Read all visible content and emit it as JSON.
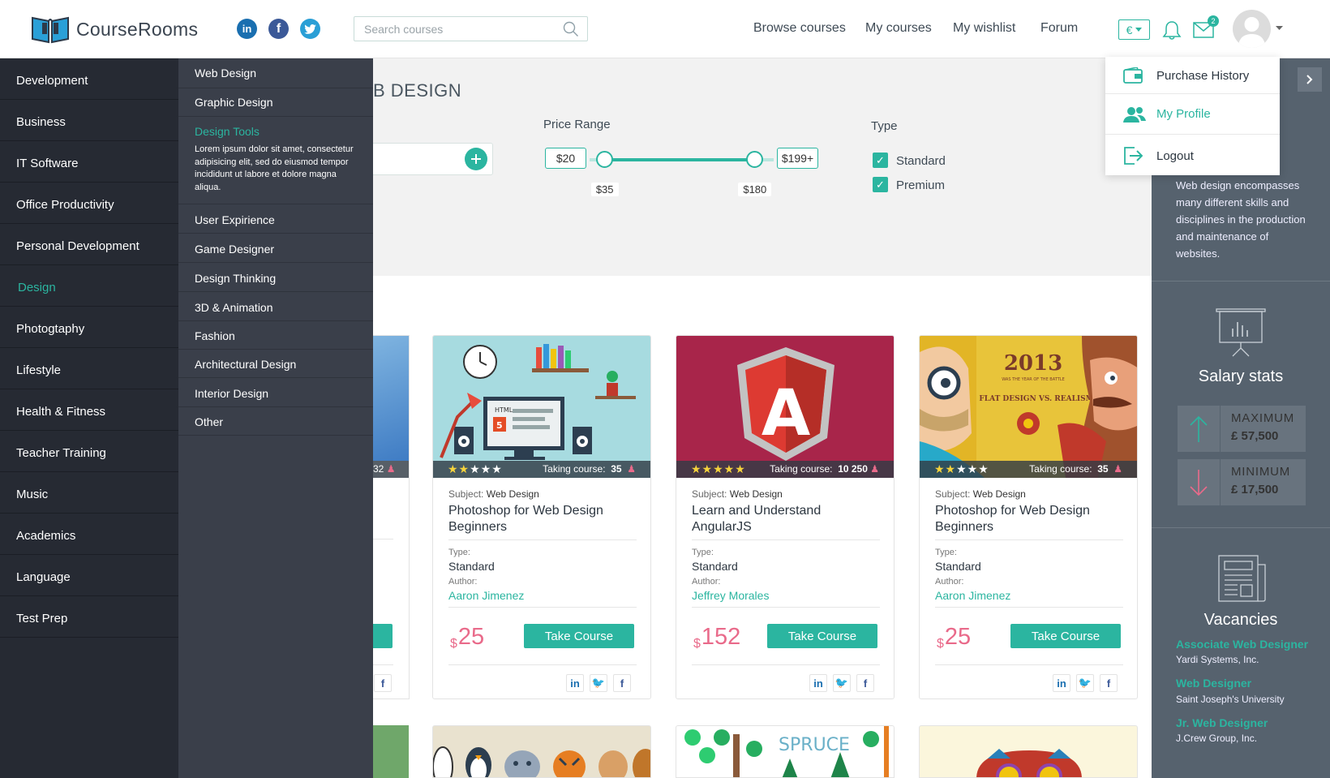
{
  "brand": {
    "name": "CourseRooms"
  },
  "social": {
    "linkedin": "in",
    "facebook": "f",
    "twitter": "t"
  },
  "search": {
    "placeholder": "Search courses"
  },
  "nav": {
    "browse": "Browse courses",
    "mycourses": "My courses",
    "wishlist": "My wishlist",
    "forum": "Forum"
  },
  "header": {
    "currency": "€",
    "notifications_count": "2"
  },
  "dropdown": {
    "items": [
      {
        "label": "Purchase History",
        "icon": "wallet-icon"
      },
      {
        "label": "My Profile",
        "icon": "users-icon"
      },
      {
        "label": "Logout",
        "icon": "logout-icon"
      }
    ]
  },
  "left_menu": {
    "items": [
      "Development",
      "Business",
      "IT Software",
      "Office Productivity",
      "Personal Development",
      "Design",
      "Photogtaphy",
      "Lifestyle",
      "Health & Fitness",
      "Teacher Training",
      "Music",
      "Academics",
      "Language",
      "Test Prep"
    ],
    "active": "Design"
  },
  "submenu": {
    "items": [
      "Web Design",
      "Graphic Design",
      "Design Tools",
      "User Expirience",
      "Game Designer",
      "Design Thinking",
      "3D & Animation",
      "Fashion",
      "Architectural Design",
      "Interior Design",
      "Other"
    ],
    "active": "Design Tools",
    "active_description": "Lorem ipsum dolor sit amet, consectetur adipisicing elit, sed do eiusmod tempor incididunt ut labore et dolore magna aliqua."
  },
  "page": {
    "title_partial": "B DESIGN"
  },
  "filters": {
    "price_label": "Price Range",
    "price_min": "$20",
    "price_max": "$199+",
    "low": "$35",
    "high": "$180",
    "range_fraction": {
      "low": 0.083,
      "high": 0.898
    },
    "type_label": "Type",
    "types": [
      {
        "label": "Standard",
        "checked": true
      },
      {
        "label": "Premium",
        "checked": true
      }
    ]
  },
  "labels": {
    "subject": "Subject:",
    "type": "Type:",
    "author": "Author:",
    "taking": "Taking course:",
    "take_btn": "Take Course",
    "currency_symbol": "$"
  },
  "partial_card": {
    "taking_tail": "32"
  },
  "courses": [
    {
      "subject": "Web Design",
      "title": "Photoshop for Web Design Beginners",
      "type": "Standard",
      "author": "Aaron Jimenez",
      "price": "25",
      "rating": 2,
      "taking": "35",
      "image": "desk-illustration"
    },
    {
      "subject": "Web Design",
      "title": "Learn and Understand AngularJS",
      "type": "Standard",
      "author": "Jeffrey Morales",
      "price": "152",
      "rating": 5,
      "taking": "10 250",
      "image": "angular-logo"
    },
    {
      "subject": "Web Design",
      "title": "Photoshop for Web Design Beginners",
      "type": "Standard",
      "author": "Aaron Jimenez",
      "price": "25",
      "rating": 2,
      "taking": "35",
      "image": "flat-vs-realism"
    }
  ],
  "card_art": {
    "year": "2013",
    "banner": "WAS THE YEAR OF THE BATTLE",
    "headline": "FLAT DESIGN VS. REALISM",
    "angular": "A",
    "html_tag": "HTML",
    "spruce": "SPRUCE"
  },
  "right_panel": {
    "description": "Web design encompasses many different skills and disciplines in the production and maintenance of websites.",
    "salary_title": "Salary stats",
    "max_label": "MAXIMUM",
    "max_value": "£ 57,500",
    "min_label": "MINIMUM",
    "min_value": "£ 17,500",
    "vacancies_title": "Vacancies",
    "vacancies": [
      {
        "title": "Associate Web Designer",
        "company": "Yardi Systems, Inc."
      },
      {
        "title": "Web Designer",
        "company": "Saint Joseph's University"
      },
      {
        "title": "Jr. Web Designer",
        "company": "J.Crew Group, Inc."
      }
    ]
  },
  "colors": {
    "accent": "#2bb5a0",
    "price": "#e96a8a",
    "sidebar": "#262a33",
    "submenu": "#3a3f4a",
    "right_panel": "#56626e",
    "star": "#f7d43c"
  }
}
